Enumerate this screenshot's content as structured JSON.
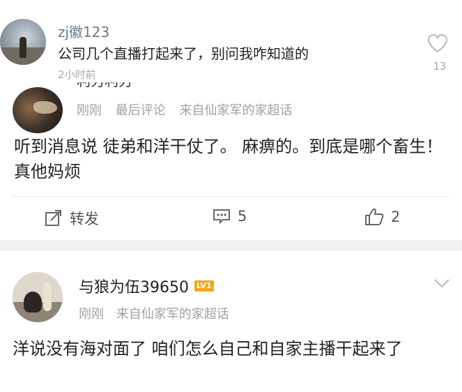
{
  "comment": {
    "username": "zj徽123",
    "text": "公司几个直播打起来了，别问我咋知道的",
    "time": "2小时前",
    "like_count": "13",
    "like_icon": "heart-outline-icon"
  },
  "post1": {
    "clipped_username": "利刃利刃",
    "meta": {
      "time": "刚刚",
      "last_comment": "最后评论",
      "source": "来自仙家军的家超话"
    },
    "body": "听到消息说 徒弟和洋干仗了。 麻痹的。到底是哪个畜生！真他妈烦",
    "actions": {
      "repost_label": "转发",
      "comment_count": "5",
      "like_count": "2"
    }
  },
  "post2": {
    "username": "与狼为伍39650",
    "level_badge": "LV1",
    "meta": {
      "time": "刚刚",
      "source": "来自仙家军的家超话"
    },
    "body": "洋说没有海对面了 咱们怎么自己和自家主播干起来了"
  },
  "colors": {
    "link_gray": "#6b7b8c",
    "meta_gray": "#a0a0a0",
    "badge_orange": "#f4a623",
    "separator": "#f2f2f2"
  }
}
